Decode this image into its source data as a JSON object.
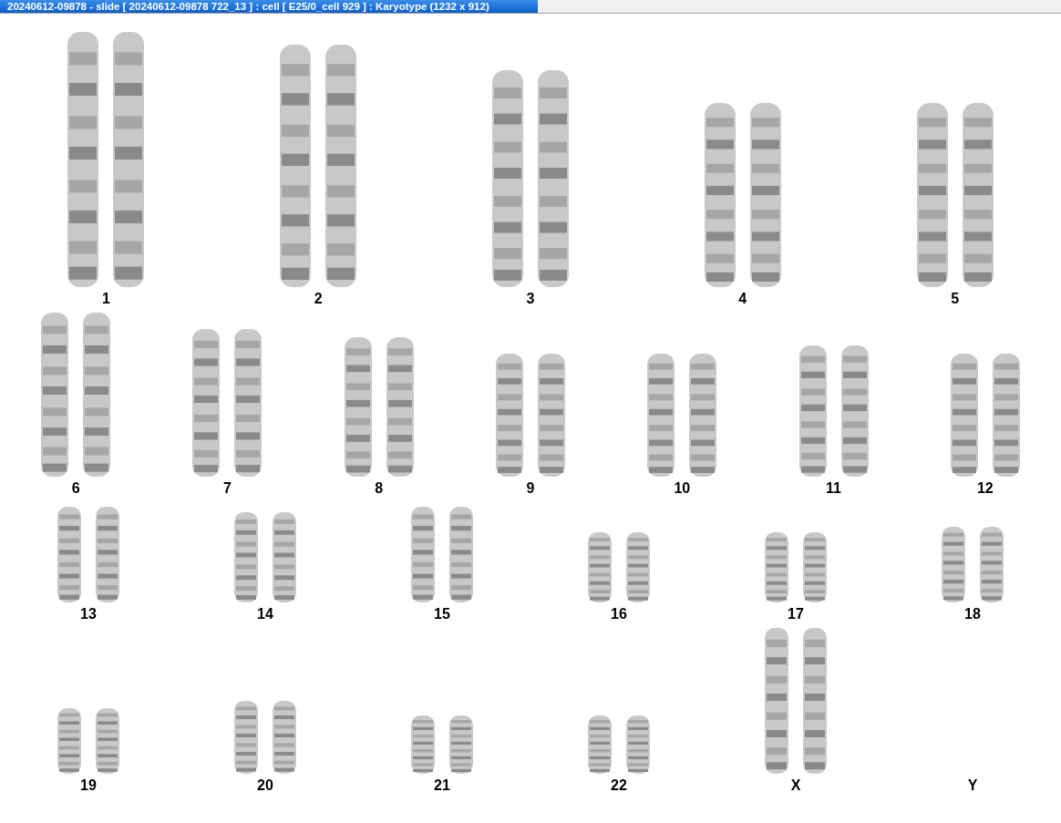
{
  "window": {
    "title": "20240612-09878 - slide [ 20240612-09878 722_13 ] : cell [ E25/0_cell 929 ] : Karyotype  (1232 x 912)"
  },
  "rows": [
    {
      "groups": [
        {
          "label": "1"
        },
        {
          "label": "2"
        },
        {
          "label": "3"
        },
        {
          "label": "4"
        },
        {
          "label": "5"
        }
      ]
    },
    {
      "groups": [
        {
          "label": "6"
        },
        {
          "label": "7"
        },
        {
          "label": "8"
        },
        {
          "label": "9"
        },
        {
          "label": "10"
        },
        {
          "label": "11"
        },
        {
          "label": "12"
        }
      ]
    },
    {
      "groups": [
        {
          "label": "13"
        },
        {
          "label": "14"
        },
        {
          "label": "15"
        },
        {
          "label": "16"
        },
        {
          "label": "17"
        },
        {
          "label": "18"
        }
      ]
    },
    {
      "groups": [
        {
          "label": "19"
        },
        {
          "label": "20"
        },
        {
          "label": "21"
        },
        {
          "label": "22"
        },
        {
          "label": "X"
        },
        {
          "label": "Y"
        }
      ]
    }
  ]
}
